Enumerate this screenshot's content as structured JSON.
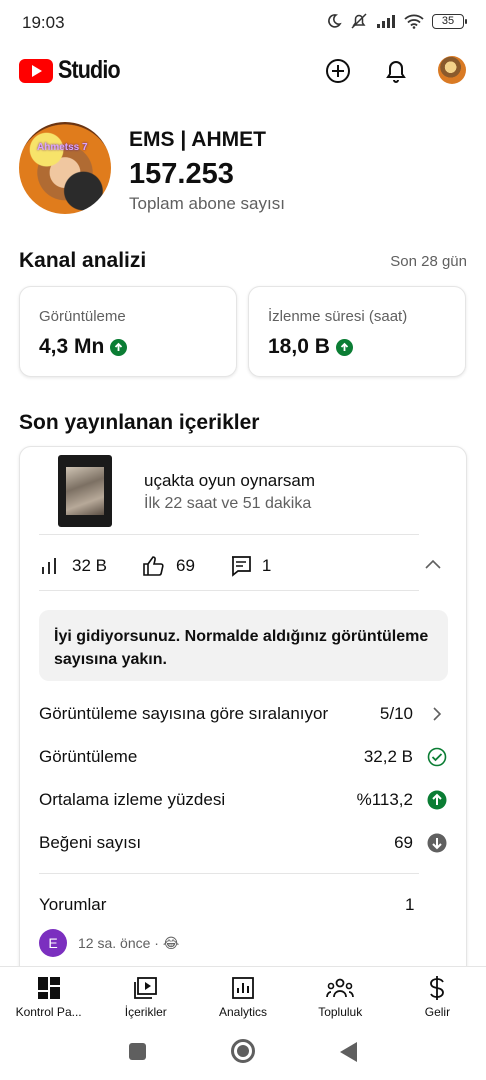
{
  "status_bar": {
    "time": "19:03",
    "battery": "35"
  },
  "app": {
    "logo_text": "Studio"
  },
  "channel": {
    "name": "EMS | AHMET",
    "subscribers": "157.253",
    "subscribers_label": "Toplam abone sayısı",
    "avatar_text": "Ahmetss 7"
  },
  "analytics": {
    "title": "Kanal analizi",
    "range": "Son 28 gün",
    "metrics": [
      {
        "label": "Görüntüleme",
        "value": "4,3 Mn",
        "trend": "up"
      },
      {
        "label": "İzlenme süresi (saat)",
        "value": "18,0 B",
        "trend": "up"
      }
    ]
  },
  "recent": {
    "title": "Son yayınlanan içerikler",
    "video": {
      "title": "uçakta oyun oynarsam",
      "subtitle": "İlk 22 saat ve 51 dakika",
      "views": "32 B",
      "likes": "69",
      "comments": "1"
    },
    "notice": "İyi gidiyorsunuz. Normalde aldığınız görüntüleme sayısına yakın.",
    "rows": [
      {
        "label": "Görüntüleme sayısına göre sıralanıyor",
        "value": "5/10",
        "icon": "chevron-right-icon"
      },
      {
        "label": "Görüntüleme",
        "value": "32,2 B",
        "icon": "check-circle-icon"
      },
      {
        "label": "Ortalama izleme yüzdesi",
        "value": "%113,2",
        "icon": "arrow-up-circle-icon"
      },
      {
        "label": "Beğeni sayısı",
        "value": "69",
        "icon": "arrow-down-circle-icon"
      }
    ],
    "comments_label": "Yorumlar",
    "comments_count": "1",
    "comment": {
      "avatar_letter": "E",
      "meta": "12 sa. önce · 😂"
    }
  },
  "bottom_nav": [
    {
      "label": "Kontrol Pa...",
      "icon": "dashboard-icon"
    },
    {
      "label": "İçerikler",
      "icon": "content-icon"
    },
    {
      "label": "Analytics",
      "icon": "analytics-icon"
    },
    {
      "label": "Topluluk",
      "icon": "community-icon"
    },
    {
      "label": "Gelir",
      "icon": "dollar-icon"
    }
  ],
  "colors": {
    "brand_red": "#ff0000",
    "trend_up": "#0b7d34",
    "comment_avatar": "#7b2fbf"
  }
}
